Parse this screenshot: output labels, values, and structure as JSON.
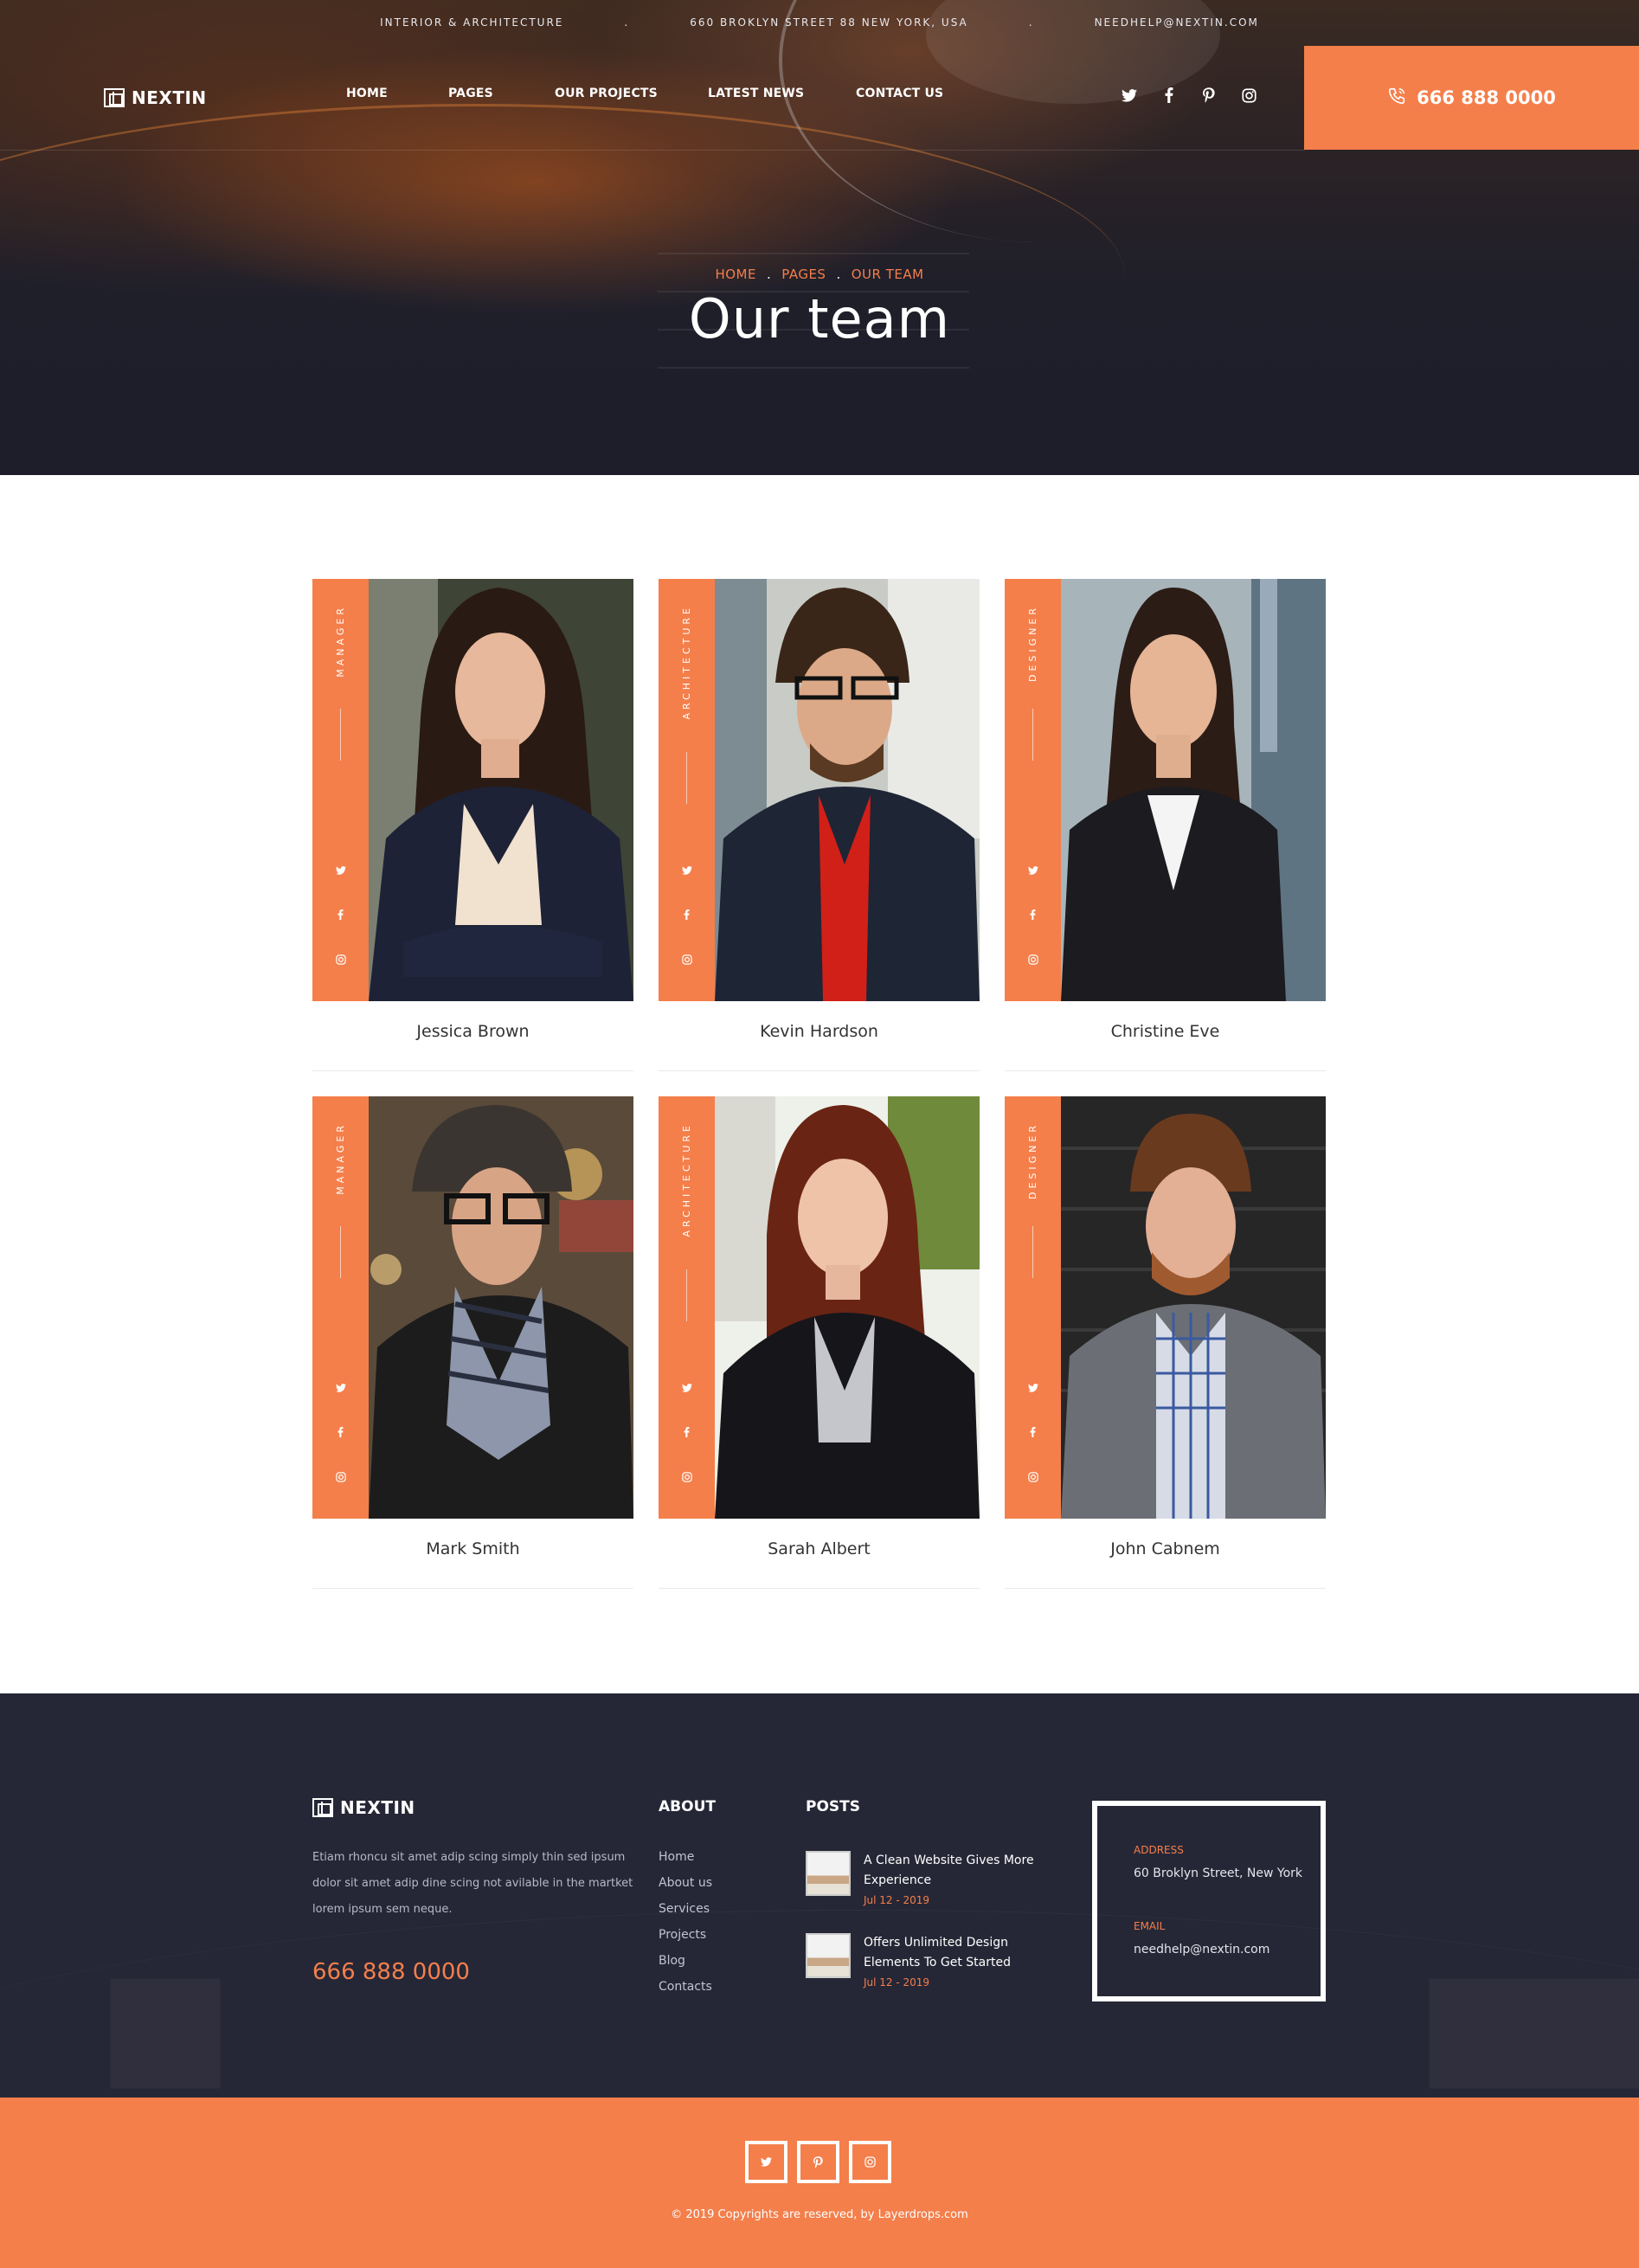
{
  "topbar": {
    "tagline": "INTERIOR & ARCHITECTURE",
    "separator": ".",
    "address": "660 BROKLYN STREET 88 NEW YORK, USA",
    "email": "NEEDHELP@NEXTIN.COM"
  },
  "brand": {
    "name": "NEXTIN"
  },
  "nav": {
    "items": [
      {
        "label": "HOME"
      },
      {
        "label": "PAGES"
      },
      {
        "label": "OUR PROJECTS"
      },
      {
        "label": "LATEST NEWS"
      },
      {
        "label": "CONTACT US"
      }
    ]
  },
  "header_social": [
    "twitter-icon",
    "facebook-icon",
    "pinterest-icon",
    "instagram-icon"
  ],
  "header_phone": "666 888 0000",
  "breadcrumb": {
    "items": [
      "HOME",
      "PAGES",
      "OUR TEAM"
    ],
    "separator": "."
  },
  "page_title": "Our team",
  "team": [
    {
      "name": "Jessica Brown",
      "role": "MANAGER"
    },
    {
      "name": "Kevin Hardson",
      "role": "ARCHITECTURE"
    },
    {
      "name": "Christine Eve",
      "role": "DESIGNER"
    },
    {
      "name": "Mark Smith",
      "role": "MANAGER"
    },
    {
      "name": "Sarah Albert",
      "role": "ARCHITECTURE"
    },
    {
      "name": "John Cabnem",
      "role": "DESIGNER"
    }
  ],
  "footer": {
    "brand": "NEXTIN",
    "description": "Etiam rhoncu sit amet adip scing simply thin sed ipsum dolor sit amet adip dine scing not avilable in the martket lorem ipsum sem neque.",
    "phone": "666 888 0000",
    "about_heading": "ABOUT",
    "about_links": [
      "Home",
      "About us",
      "Services",
      "Projects",
      "Blog",
      "Contacts"
    ],
    "posts_heading": "POSTS",
    "posts": [
      {
        "title": "A Clean Website Gives More Experience",
        "date": "Jul 12 - 2019"
      },
      {
        "title": "Offers Unlimited Design Elements To Get Started",
        "date": "Jul 12 - 2019"
      }
    ],
    "address_label": "ADDRESS",
    "address_value": "60 Broklyn Street, New York",
    "email_label": "EMAIL",
    "email_value": "needhelp@nextin.com"
  },
  "bottom": {
    "social": [
      "twitter-icon",
      "pinterest-icon",
      "instagram-icon"
    ],
    "copyright": "© 2019 Copyrights are reserved, by Layerdrops.com"
  },
  "colors": {
    "accent": "#f47f4b",
    "dark": "#262736",
    "hero_dark": "#1d1e2a"
  }
}
